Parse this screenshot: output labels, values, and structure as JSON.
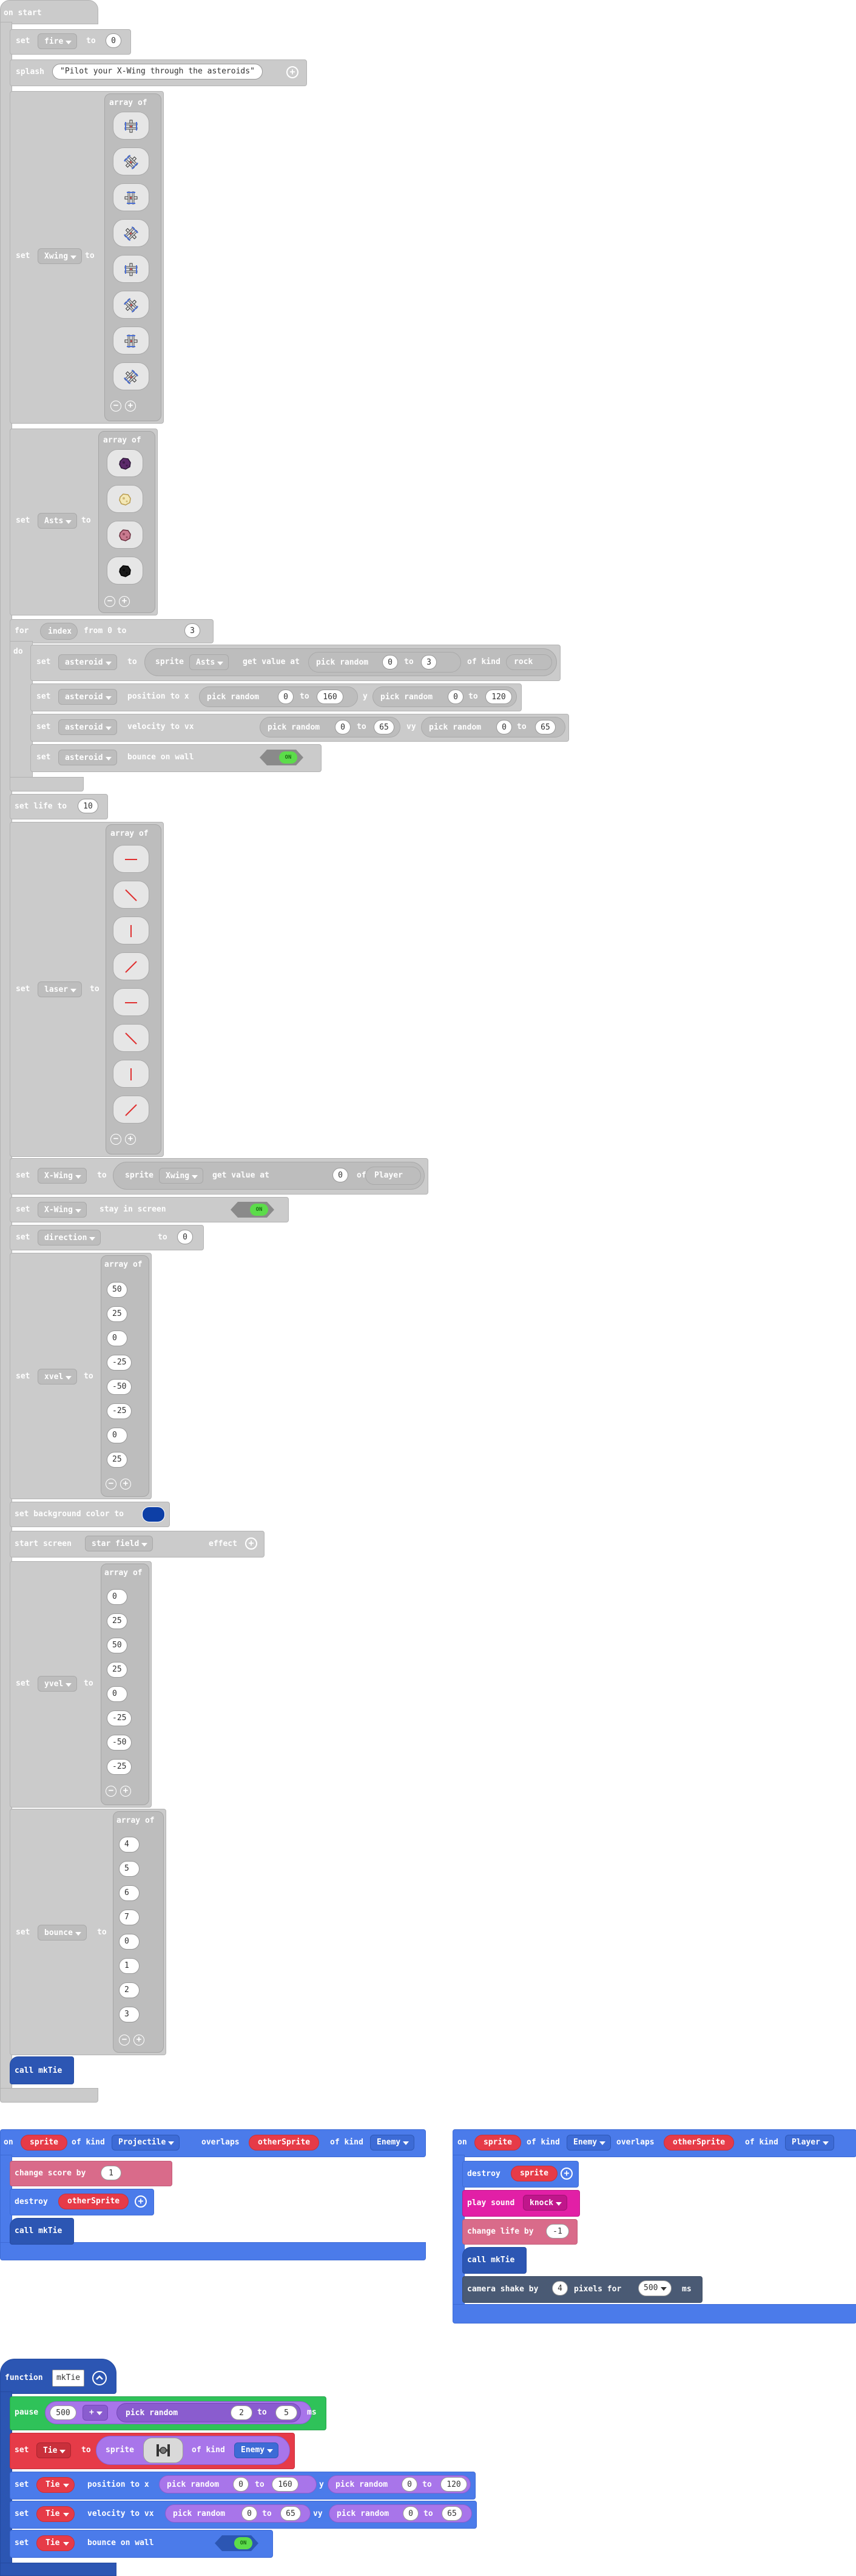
{
  "on_start": {
    "hat": "on start",
    "set_fire": {
      "set": "set",
      "var": "fire",
      "to": "to",
      "value": "0"
    },
    "splash": {
      "label": "splash",
      "text": "\"Pilot your X-Wing through the asteroids\""
    },
    "set_xwing_imgs": {
      "set": "set",
      "var": "Xwing",
      "to": "to",
      "array_of": "array of",
      "icons": [
        "xwing-up-icon",
        "xwing-diag-icon",
        "xwing-right-icon",
        "xwing-diag2-icon",
        "xwing-down-icon",
        "xwing-diag3-icon",
        "xwing-left-icon",
        "xwing-diag4-icon"
      ]
    },
    "set_asts": {
      "set": "set",
      "var": "Asts",
      "to": "to",
      "array_of": "array of",
      "icons": [
        "asteroid-purple-icon",
        "asteroid-cream-icon",
        "asteroid-pink-icon",
        "asteroid-black-icon"
      ]
    },
    "for_loop": {
      "for": "for",
      "var": "index",
      "from": "from 0 to",
      "to_value": "3",
      "do": "do"
    },
    "loop_set_asteroid": {
      "set": "set",
      "var": "asteroid",
      "to": "to",
      "sprite": "sprite",
      "arr": "Asts",
      "get": "get value at",
      "pick": "pick random",
      "a": "0",
      "to2": "to",
      "b": "3",
      "of_kind": "of kind",
      "kind": "rock"
    },
    "loop_pos": {
      "set": "set",
      "var": "asteroid",
      "label": "position to x",
      "pick": "pick random",
      "x1": "0",
      "to": "to",
      "x2": "160",
      "y": "y",
      "y1": "0",
      "y2": "120"
    },
    "loop_vel": {
      "set": "set",
      "var": "asteroid",
      "label": "velocity to vx",
      "pick": "pick random",
      "vx1": "0",
      "to": "to",
      "vx2": "65",
      "vy": "vy",
      "vy1": "0",
      "vy2": "65"
    },
    "loop_bounce": {
      "set": "set",
      "var": "asteroid",
      "label": "bounce on wall",
      "toggle": "ON"
    },
    "set_life": {
      "label": "set life to",
      "value": "10"
    },
    "set_laser": {
      "set": "set",
      "var": "laser",
      "to": "to",
      "array_of": "array of",
      "icons": [
        "laser-horizontal-icon",
        "laser-diag-icon",
        "laser-vertical-icon",
        "laser-diag2-icon",
        "laser-horizontal2-icon",
        "laser-diag3-icon",
        "laser-vertical2-icon",
        "laser-diag4-icon"
      ]
    },
    "set_player": {
      "set": "set",
      "var": "X-Wing",
      "to": "to",
      "sprite": "sprite",
      "arr": "Xwing",
      "get": "get value at",
      "idx": "0",
      "of_kind": "of kind",
      "kind": "Player"
    },
    "stay_screen": {
      "set": "set",
      "var": "X-Wing",
      "label": "stay in screen",
      "toggle": "ON"
    },
    "set_direction": {
      "set": "set",
      "var": "direction",
      "to": "to",
      "value": "0"
    },
    "set_xvel": {
      "set": "set",
      "var": "xvel",
      "to": "to",
      "array_of": "array of",
      "values": [
        "50",
        "25",
        "0",
        "-25",
        "-50",
        "-25",
        "0",
        "25"
      ]
    },
    "bg_color": {
      "label": "set background color to",
      "color": "#0d3fa6"
    },
    "start_screen": {
      "label": "start screen",
      "effect": "star field",
      "suffix": "effect"
    },
    "set_yvel": {
      "set": "set",
      "var": "yvel",
      "to": "to",
      "array_of": "array of",
      "values": [
        "0",
        "25",
        "50",
        "25",
        "0",
        "-25",
        "-50",
        "-25"
      ]
    },
    "set_bounce": {
      "set": "set",
      "var": "bounce",
      "to": "to",
      "array_of": "array of",
      "values": [
        "4",
        "5",
        "6",
        "7",
        "0",
        "1",
        "2",
        "3"
      ]
    },
    "call": {
      "label": "call mkTie"
    }
  },
  "overlap1": {
    "on": "on",
    "sprite": "sprite",
    "of_kind": "of kind",
    "kind": "Projectile",
    "overlaps": "overlaps",
    "other": "otherSprite",
    "of_kind2": "of kind",
    "kind2": "Enemy",
    "change_score": {
      "label": "change score by",
      "value": "1"
    },
    "destroy": {
      "label": "destroy",
      "target": "otherSprite"
    },
    "call": "call mkTie"
  },
  "overlap2": {
    "on": "on",
    "sprite": "sprite",
    "of_kind": "of kind",
    "kind": "Enemy",
    "overlaps": "overlaps",
    "other": "otherSprite",
    "of_kind2": "of kind",
    "kind2": "Player",
    "destroy": {
      "label": "destroy",
      "target": "sprite"
    },
    "sound": {
      "label": "play sound",
      "sound": "knock"
    },
    "change_life": {
      "label": "change life by",
      "value": "-1"
    },
    "call": "call mkTie",
    "shake": {
      "label": "camera shake by",
      "value": "4",
      "pixels": "pixels for",
      "ms_value": "500",
      "ms": "ms"
    }
  },
  "function": {
    "label": "function",
    "name": "mkTie",
    "pause": {
      "label": "pause",
      "value": "500",
      "op": "+",
      "pick": "pick random",
      "a": "2",
      "to": "to",
      "b": "5",
      "ms": "ms"
    },
    "set_tie": {
      "set": "set",
      "var": "Tie",
      "to": "to",
      "sprite": "sprite",
      "of_kind": "of kind",
      "kind": "Enemy"
    },
    "pos": {
      "set": "set",
      "var": "Tie",
      "label": "position to x",
      "pick": "pick random",
      "x1": "0",
      "to": "to",
      "x2": "160",
      "y": "y",
      "y1": "0",
      "y2": "120"
    },
    "vel": {
      "set": "set",
      "var": "Tie",
      "label": "velocity to vx",
      "pick": "pick random",
      "vx1": "0",
      "to": "to",
      "vx2": "65",
      "vy": "vy",
      "vy1": "0",
      "vy2": "65"
    },
    "bounce": {
      "set": "set",
      "var": "Tie",
      "label": "bounce on wall",
      "toggle": "ON"
    }
  }
}
